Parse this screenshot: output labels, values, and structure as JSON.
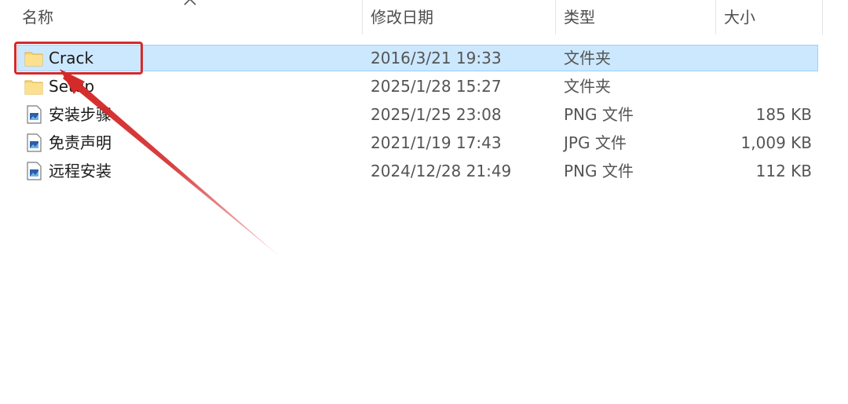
{
  "header": {
    "name": "名称",
    "modified": "修改日期",
    "type": "类型",
    "size": "大小"
  },
  "files": [
    {
      "name": "Crack",
      "modified": "2016/3/21 19:33",
      "type": "文件夹",
      "size": "",
      "icon": "folder-icon",
      "selected": true
    },
    {
      "name": "Setup",
      "modified": "2025/1/28 15:27",
      "type": "文件夹",
      "size": "",
      "icon": "folder-icon",
      "selected": false
    },
    {
      "name": "安装步骤",
      "modified": "2025/1/25 23:08",
      "type": "PNG 文件",
      "size": "185 KB",
      "icon": "image-file-icon",
      "selected": false
    },
    {
      "name": "免责声明",
      "modified": "2021/1/19 17:43",
      "type": "JPG 文件",
      "size": "1,009 KB",
      "icon": "image-file-icon",
      "selected": false
    },
    {
      "name": "远程安装",
      "modified": "2024/12/28 21:49",
      "type": "PNG 文件",
      "size": "112 KB",
      "icon": "image-file-icon",
      "selected": false
    }
  ],
  "colors": {
    "selection_bg": "#cce8ff",
    "annotation_red": "#d42a2a",
    "folder_yellow": "#f8d775"
  }
}
